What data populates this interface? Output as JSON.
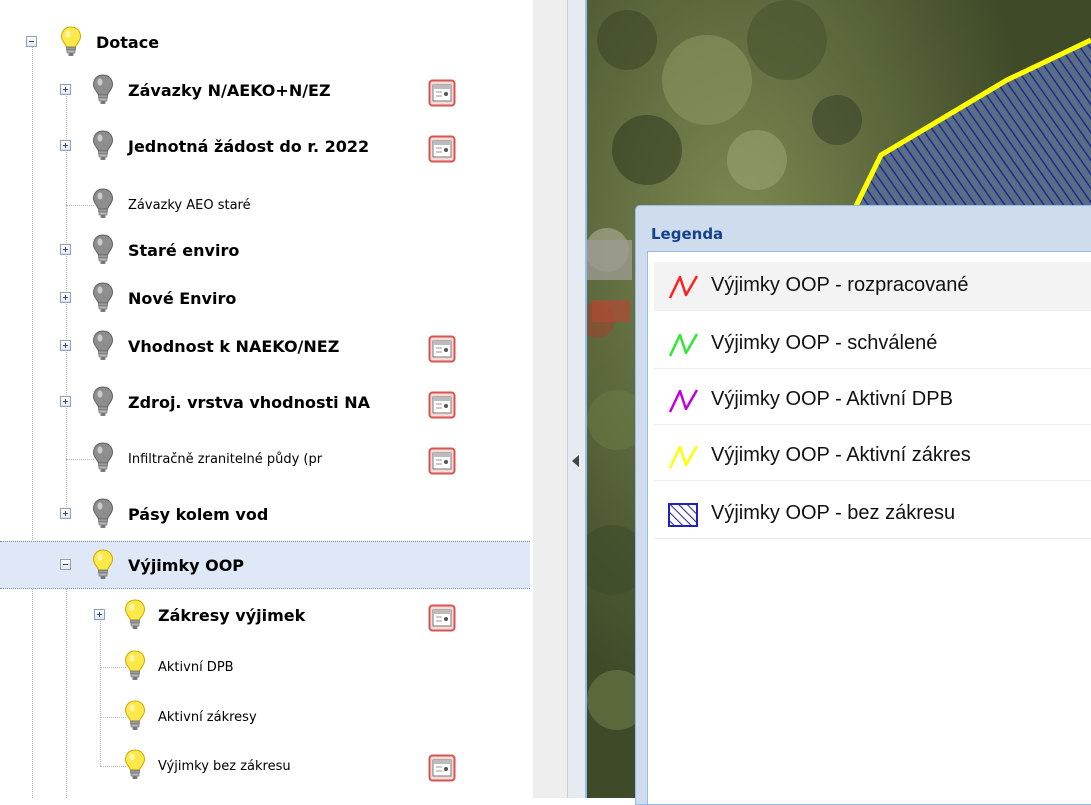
{
  "tree": {
    "items": [
      {
        "label": "Dotace",
        "state": "expanded",
        "bulb": "on",
        "bold": true,
        "config": false
      },
      {
        "label": "Závazky N/AEKO+N/EZ",
        "state": "collapsed",
        "bulb": "off",
        "bold": true,
        "config": true
      },
      {
        "label": "Jednotná žádost do r. 2022",
        "state": "collapsed",
        "bulb": "off",
        "bold": true,
        "config": true
      },
      {
        "label": "Závazky AEO staré",
        "state": "leaf",
        "bulb": "off",
        "bold": false,
        "config": false
      },
      {
        "label": "Staré enviro",
        "state": "collapsed",
        "bulb": "off",
        "bold": true,
        "config": false
      },
      {
        "label": "Nové Enviro",
        "state": "collapsed",
        "bulb": "off",
        "bold": true,
        "config": false
      },
      {
        "label": "Vhodnost k NAEKO/NEZ",
        "state": "collapsed",
        "bulb": "off",
        "bold": true,
        "config": true
      },
      {
        "label": "Zdroj. vrstva vhodnosti NA",
        "state": "collapsed",
        "bulb": "off",
        "bold": true,
        "config": true
      },
      {
        "label": "Infiltračně zranitelné půdy (pr",
        "state": "leaf",
        "bulb": "off",
        "bold": false,
        "config": true
      },
      {
        "label": "Pásy kolem vod",
        "state": "collapsed",
        "bulb": "off",
        "bold": true,
        "config": false
      },
      {
        "label": "Výjimky OOP",
        "state": "expanded",
        "bulb": "on",
        "bold": true,
        "config": false,
        "selected": true
      },
      {
        "label": "Zákresy výjimek",
        "state": "collapsed",
        "bulb": "on",
        "bold": true,
        "config": true
      },
      {
        "label": "Aktivní DPB",
        "state": "leaf",
        "bulb": "on",
        "bold": false,
        "config": false
      },
      {
        "label": "Aktivní zákresy",
        "state": "leaf",
        "bulb": "on",
        "bold": false,
        "config": false
      },
      {
        "label": "Výjimky bez zákresu",
        "state": "leaf",
        "bulb": "on",
        "bold": false,
        "config": true
      }
    ]
  },
  "legend": {
    "title": "Legenda",
    "items": [
      {
        "label": "Výjimky OOP - rozpracované",
        "symbol": "line",
        "color": "#ff2020"
      },
      {
        "label": "Výjimky OOP - schválené",
        "symbol": "line",
        "color": "#33e633"
      },
      {
        "label": "Výjimky OOP - Aktivní DPB",
        "symbol": "line",
        "color": "#c000e0"
      },
      {
        "label": "Výjimky OOP - Aktivní zákres",
        "symbol": "line",
        "color": "#ffff00"
      },
      {
        "label": "Výjimky OOP - bez zákresu",
        "symbol": "hatch",
        "color": "#2222bb"
      }
    ]
  },
  "icons": {
    "expand": "plus-box-icon",
    "collapse": "minus-box-icon",
    "layer_on": "lightbulb-on-icon",
    "layer_off": "lightbulb-off-icon",
    "config": "layer-settings-icon",
    "splitter": "collapse-arrow-icon"
  },
  "colors": {
    "selection_bg": "#dfe8f6",
    "legend_header": "#cfdcee",
    "legend_title": "#15428b",
    "map_outline": "#ffff00"
  }
}
